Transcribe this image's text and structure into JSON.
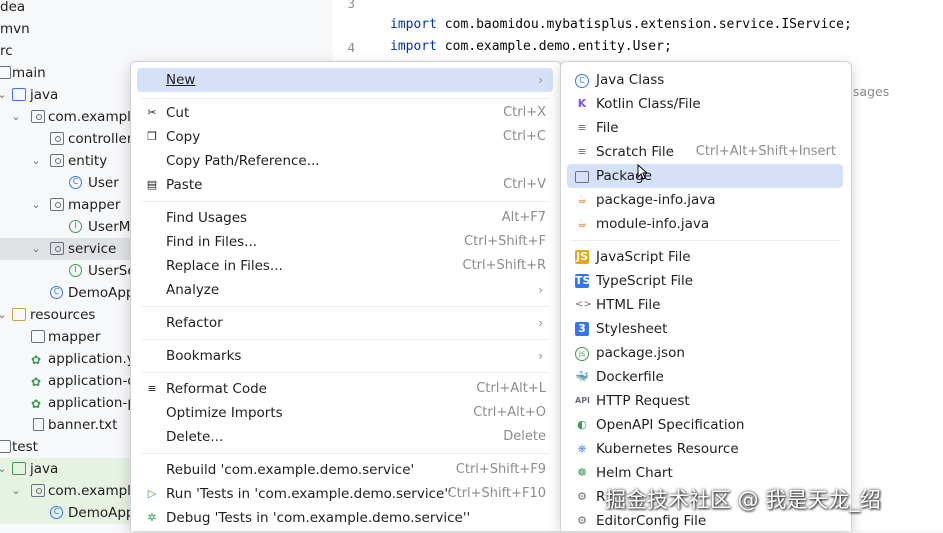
{
  "tree": {
    "rows": [
      {
        "label": "dea"
      },
      {
        "label": "mvn"
      },
      {
        "label": "rc"
      },
      {
        "label": "main"
      },
      {
        "label": "java"
      },
      {
        "label": "com.example"
      },
      {
        "label": "controller"
      },
      {
        "label": "entity"
      },
      {
        "label": "User"
      },
      {
        "label": "mapper"
      },
      {
        "label": "UserMa"
      },
      {
        "label": "service"
      },
      {
        "label": "UserSe"
      },
      {
        "label": "DemoApp"
      },
      {
        "label": "resources"
      },
      {
        "label": "mapper"
      },
      {
        "label": "application.ym"
      },
      {
        "label": "application-d"
      },
      {
        "label": "application-p"
      },
      {
        "label": "banner.txt"
      },
      {
        "label": "test"
      },
      {
        "label": "java"
      },
      {
        "label": "com.example"
      },
      {
        "label": "DemoApp"
      }
    ]
  },
  "editor": {
    "lines": [
      {
        "num": "3",
        "keyword": "import",
        "text": " com.baomidou.mybatisplus.extension.service.IService;"
      },
      {
        "num": "4",
        "keyword": "import",
        "text": " com.example.demo.entity.User;"
      }
    ],
    "usages": "usages"
  },
  "context_menu": {
    "new": {
      "label": "New"
    },
    "cut": {
      "label": "Cut",
      "shortcut": "Ctrl+X"
    },
    "copy": {
      "label": "Copy",
      "shortcut": "Ctrl+C"
    },
    "copy_path": {
      "label": "Copy Path/Reference..."
    },
    "paste": {
      "label": "Paste",
      "shortcut": "Ctrl+V"
    },
    "find_usages": {
      "label": "Find Usages",
      "shortcut": "Alt+F7"
    },
    "find_in_files": {
      "label": "Find in Files...",
      "shortcut": "Ctrl+Shift+F"
    },
    "replace_in_files": {
      "label": "Replace in Files...",
      "shortcut": "Ctrl+Shift+R"
    },
    "analyze": {
      "label": "Analyze"
    },
    "refactor": {
      "label": "Refactor"
    },
    "bookmarks": {
      "label": "Bookmarks"
    },
    "reformat_code": {
      "label": "Reformat Code",
      "shortcut": "Ctrl+Alt+L"
    },
    "optimize_imports": {
      "label": "Optimize Imports",
      "shortcut": "Ctrl+Alt+O"
    },
    "delete": {
      "label": "Delete...",
      "shortcut": "Delete"
    },
    "rebuild": {
      "label": "Rebuild 'com.example.demo.service'",
      "shortcut": "Ctrl+Shift+F9"
    },
    "run": {
      "label": "Run 'Tests in 'com.example.demo.service''",
      "shortcut": "Ctrl+Shift+F10"
    },
    "debug": {
      "label": "Debug 'Tests in 'com.example.demo.service''"
    }
  },
  "new_submenu": {
    "java_class": {
      "label": "Java Class"
    },
    "kotlin_class": {
      "label": "Kotlin Class/File"
    },
    "file": {
      "label": "File"
    },
    "scratch_file": {
      "label": "Scratch File",
      "shortcut": "Ctrl+Alt+Shift+Insert"
    },
    "package": {
      "label": "Package"
    },
    "package_info": {
      "label": "package-info.java"
    },
    "module_info": {
      "label": "module-info.java"
    },
    "javascript_file": {
      "label": "JavaScript File"
    },
    "typescript_file": {
      "label": "TypeScript File"
    },
    "html_file": {
      "label": "HTML File"
    },
    "stylesheet": {
      "label": "Stylesheet"
    },
    "package_json": {
      "label": "package.json"
    },
    "dockerfile": {
      "label": "Dockerfile"
    },
    "http_request": {
      "label": "HTTP Request"
    },
    "openapi": {
      "label": "OpenAPI Specification"
    },
    "kubernetes": {
      "label": "Kubernetes Resource"
    },
    "helm_chart": {
      "label": "Helm Chart"
    },
    "resource_bundle": {
      "label": "R"
    },
    "editorconfig": {
      "label": "EditorConfig File"
    }
  },
  "watermark": "掘金技术社区 @ 我是天龙_绍",
  "colors": {
    "accent": "#3574f0",
    "highlight": "#d5e1f8",
    "keyword": "#0033b3",
    "test_green": "#e6f2e2"
  }
}
